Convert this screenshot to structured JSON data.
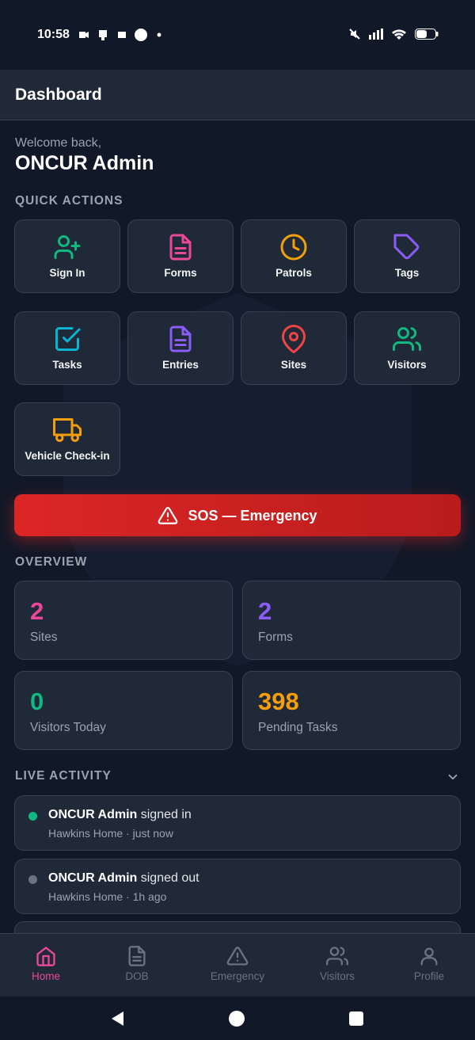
{
  "status_bar": {
    "time": "10:58"
  },
  "app_bar": {
    "title": "Dashboard"
  },
  "welcome": {
    "greeting": "Welcome back,",
    "user": "ONCUR Admin"
  },
  "quick_actions": {
    "title": "QUICK ACTIONS",
    "items": [
      {
        "label": "Sign In",
        "icon": "user-plus-icon",
        "color": "#10b981"
      },
      {
        "label": "Forms",
        "icon": "document-icon",
        "color": "#ec4899"
      },
      {
        "label": "Patrols",
        "icon": "clock-icon",
        "color": "#f59e0b"
      },
      {
        "label": "Tags",
        "icon": "tag-icon",
        "color": "#8b5cf6"
      },
      {
        "label": "Tasks",
        "icon": "checkbox-icon",
        "color": "#06b6d4"
      },
      {
        "label": "Entries",
        "icon": "document-icon",
        "color": "#8b5cf6"
      },
      {
        "label": "Sites",
        "icon": "map-pin-icon",
        "color": "#ef4444"
      },
      {
        "label": "Visitors",
        "icon": "users-icon",
        "color": "#10b981"
      },
      {
        "label": "Vehicle Check-in",
        "icon": "truck-icon",
        "color": "#f59e0b"
      }
    ]
  },
  "sos": {
    "label": "SOS — Emergency",
    "icon": "warning-icon"
  },
  "overview": {
    "title": "OVERVIEW",
    "stats": [
      {
        "value": "2",
        "label": "Sites",
        "color": "#ec4899"
      },
      {
        "value": "2",
        "label": "Forms",
        "color": "#8b5cf6"
      },
      {
        "value": "0",
        "label": "Visitors Today",
        "color": "#10b981"
      },
      {
        "value": "398",
        "label": "Pending Tasks",
        "color": "#f59e0b"
      }
    ]
  },
  "live_activity": {
    "title": "LIVE ACTIVITY",
    "items": [
      {
        "user": "ONCUR Admin",
        "action": "signed in",
        "location": "Hawkins Home",
        "time": "just now",
        "status_color": "#10b981"
      },
      {
        "user": "ONCUR Admin",
        "action": "signed out",
        "location": "Hawkins Home",
        "time": "1h ago",
        "status_color": "#6b7280"
      }
    ]
  },
  "bottom_nav": {
    "active_color": "#ec4899",
    "items": [
      {
        "label": "Home",
        "icon": "home-icon",
        "active": true
      },
      {
        "label": "DOB",
        "icon": "document-icon",
        "active": false
      },
      {
        "label": "Emergency",
        "icon": "warning-icon",
        "active": false
      },
      {
        "label": "Visitors",
        "icon": "users-icon",
        "active": false
      },
      {
        "label": "Profile",
        "icon": "user-icon",
        "active": false
      }
    ]
  }
}
